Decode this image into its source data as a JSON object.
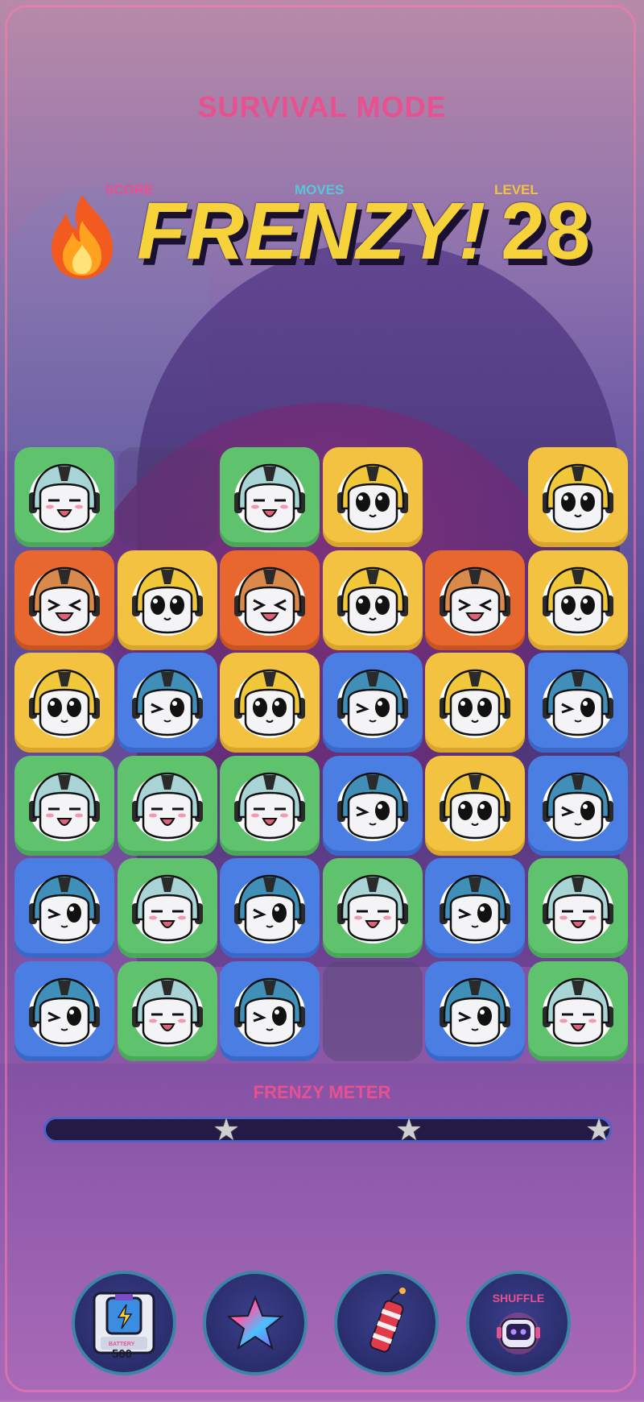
{
  "header": {
    "mode_title": "SURVIVAL MODE",
    "score_label": "SCORE",
    "moves_label": "MOVES",
    "level_label": "LEVEL",
    "frenzy_text": "FRENZY!",
    "level_value": "28"
  },
  "board": {
    "rows": [
      [
        "green-face",
        "empty",
        "green-face",
        "yellow-face",
        "gap",
        "yellow-face"
      ],
      [
        "orange-face",
        "yellow-face",
        "orange-face",
        "yellow-face",
        "orange-face",
        "yellow-face"
      ],
      [
        "yellow-face",
        "blue-face",
        "yellow-face",
        "blue-face",
        "yellow-face",
        "blue-face"
      ],
      [
        "green-face",
        "green-face",
        "green-face",
        "blue-face",
        "yellow-face",
        "blue-face"
      ],
      [
        "blue-face",
        "green-face",
        "blue-face",
        "green-face",
        "blue-face",
        "green-face"
      ],
      [
        "blue-face",
        "green-face",
        "blue-face",
        "empty-slot",
        "blue-face",
        "green-face"
      ]
    ],
    "tile_colors": {
      "green": "#5fc36d",
      "yellow": "#f2c240",
      "orange": "#e7672e",
      "blue": "#4a7ee3"
    }
  },
  "meter": {
    "title": "FRENZY METER",
    "fill_fraction": 0,
    "stars": 3
  },
  "powerups": {
    "battery_label": "BATTERY",
    "battery_value": "500",
    "shuffle_label": "SHUFFLE"
  },
  "colors": {
    "accent_pink": "#e8508f",
    "frenzy_yellow": "#f7d33b",
    "moves_cyan": "#58c6d8",
    "level_yellow": "#f2c240"
  }
}
